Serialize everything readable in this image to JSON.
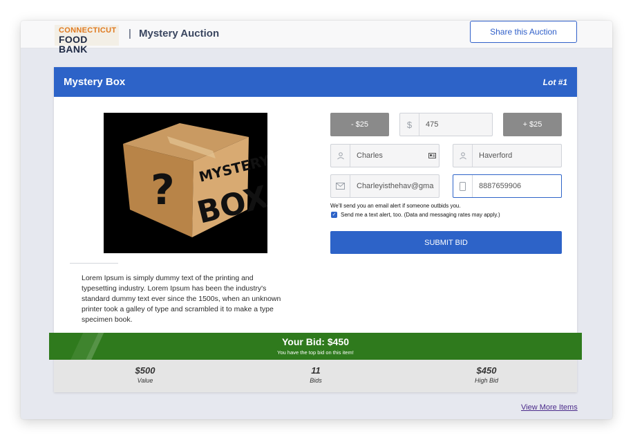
{
  "header": {
    "logo_line1": "CONNECTICUT",
    "logo_line2": "FOOD BANK",
    "divider": "|",
    "title": "Mystery Auction",
    "share_label": "Share this Auction"
  },
  "item": {
    "title": "Mystery Box",
    "lot": "Lot #1",
    "image_text_line1": "MYSTERY",
    "image_text_line2": "BOX",
    "description": "Lorem Ipsum is simply dummy text of the printing and typesetting industry. Lorem Ipsum has been the industry's standard dummy text ever since the 1500s, when an unknown printer took a galley of type and scrambled it to make a type specimen book."
  },
  "bid_form": {
    "decrement_label": "- $25",
    "increment_label": "+ $25",
    "currency_symbol": "$",
    "amount_value": "475",
    "first_name_value": "Charles",
    "last_name_value": "Haverford",
    "email_value": "Charleyisthehav@gma",
    "phone_value": "8887659906",
    "email_note": "We'll send you an email alert if someone outbids you.",
    "text_alert_label": "Send me a text alert, too. (Data and messaging rates may apply.)",
    "text_alert_checked": true,
    "submit_label": "SUBMIT BID"
  },
  "status": {
    "your_bid": "Your Bid: $450",
    "message": "You have the top bid on this item!"
  },
  "stats": [
    {
      "value": "$500",
      "label": "Value"
    },
    {
      "value": "11",
      "label": "Bids"
    },
    {
      "value": "$450",
      "label": "High Bid"
    }
  ],
  "footer": {
    "more_link": "View More Items"
  },
  "colors": {
    "primary": "#2d63c8",
    "success": "#2f7a1d",
    "step_button": "#8a8a8a",
    "logo_orange": "#e07a1f"
  }
}
